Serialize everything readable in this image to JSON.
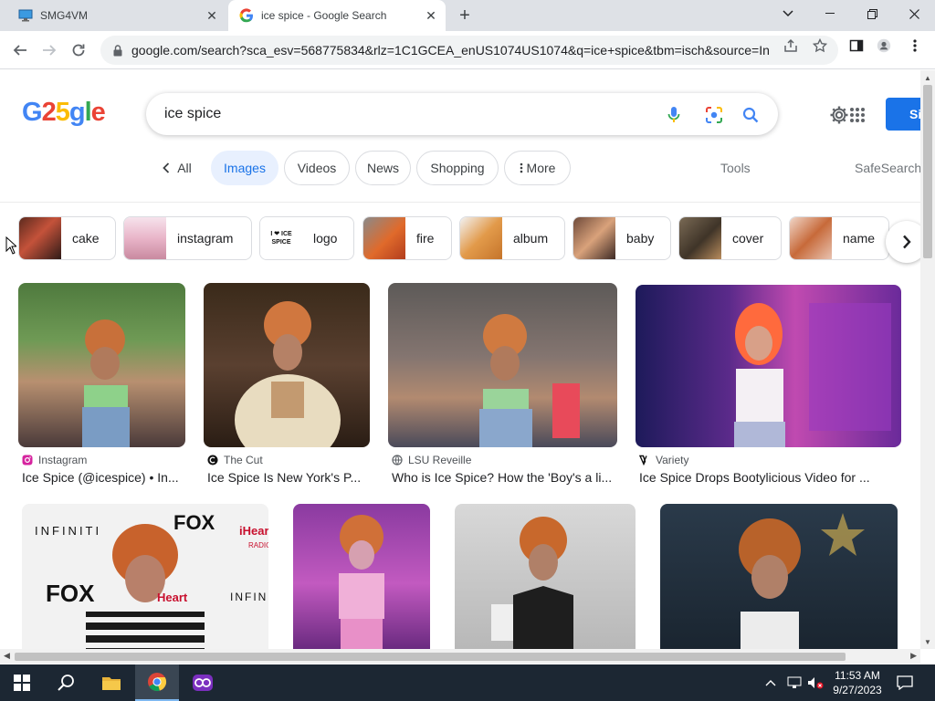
{
  "browser": {
    "tabs": [
      {
        "title": "SMG4VM"
      },
      {
        "title": "ice spice - Google Search"
      }
    ],
    "url": "google.com/search?sca_esv=568775834&rlz=1C1GCEA_enUS1074US1074&q=ice+spice&tbm=isch&source=In..."
  },
  "google": {
    "logo": {
      "p1": "G",
      "p2": "2",
      "p3": "5",
      "p4": "g",
      "p5": "l",
      "p6": "e"
    },
    "query": "ice spice",
    "signin_label": "Si",
    "filters": {
      "all": "All",
      "images": "Images",
      "videos": "Videos",
      "news": "News",
      "shopping": "Shopping",
      "more": "More",
      "tools": "Tools",
      "safesearch": "SafeSearch"
    },
    "related": [
      {
        "label": "cake"
      },
      {
        "label": "instagram"
      },
      {
        "label": "logo",
        "thumb_text": "I ❤ ICE SPICE"
      },
      {
        "label": "fire"
      },
      {
        "label": "album"
      },
      {
        "label": "baby"
      },
      {
        "label": "cover"
      },
      {
        "label": "name"
      }
    ],
    "results": [
      {
        "source": "Instagram",
        "title": "Ice Spice (@icespice) • In..."
      },
      {
        "source": "The Cut",
        "title": "Ice Spice Is New York's P..."
      },
      {
        "source": "LSU Reveille",
        "title": "Who is Ice Spice? How the 'Boy's a li..."
      },
      {
        "source": "Variety",
        "title": "Ice Spice Drops Bootylicious Video for ..."
      }
    ],
    "row2_texts": {
      "infiniti": "INFINITI",
      "fox": "FOX",
      "iheart": "iHeart",
      "radio": "RADIO",
      "infin": "INFIN",
      "fox_top": "FOX"
    }
  },
  "taskbar": {
    "time": "11:53 AM",
    "date": "9/27/2023"
  },
  "colors": {
    "google_blue": "#4285f4",
    "google_red": "#ea4335",
    "google_yellow": "#fbbc05",
    "google_green": "#34a853",
    "active_chip_bg": "#e8f0fe",
    "taskbar_bg": "#1c2733"
  }
}
